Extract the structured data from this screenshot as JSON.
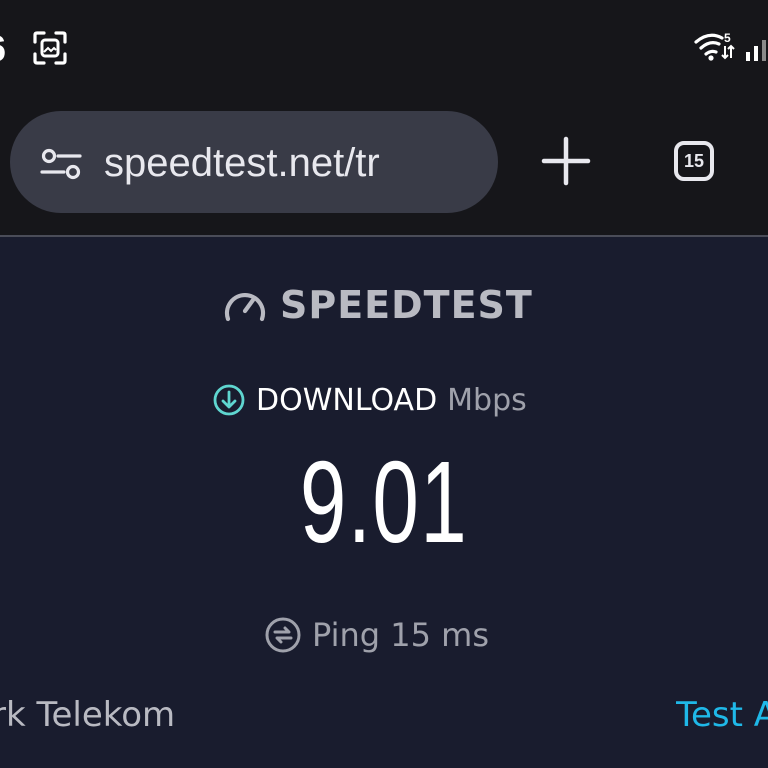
{
  "status_bar": {
    "time": "6",
    "screenshot_icon": "screenshot-icon",
    "wifi_icon": "wifi-icon",
    "wifi_badge": "5",
    "signal_icon": "signal-icon"
  },
  "toolbar": {
    "url": "speedtest.net/tr",
    "site_settings_icon": "tune-icon",
    "new_tab_icon": "plus-icon",
    "tab_count": "15"
  },
  "page": {
    "brand": "SPEEDTEST",
    "download_label": "DOWNLOAD",
    "unit": "Mbps",
    "download_value": "9.01",
    "ping_text": "Ping 15 ms",
    "isp": "rk Telekom",
    "test_link": "Test A"
  },
  "colors": {
    "page_bg": "#191c2e",
    "toolbar_bg": "#16161a",
    "urlbar_bg": "#393b47",
    "accent_teal": "#5fd6d0",
    "link_blue": "#1fb8e8"
  }
}
